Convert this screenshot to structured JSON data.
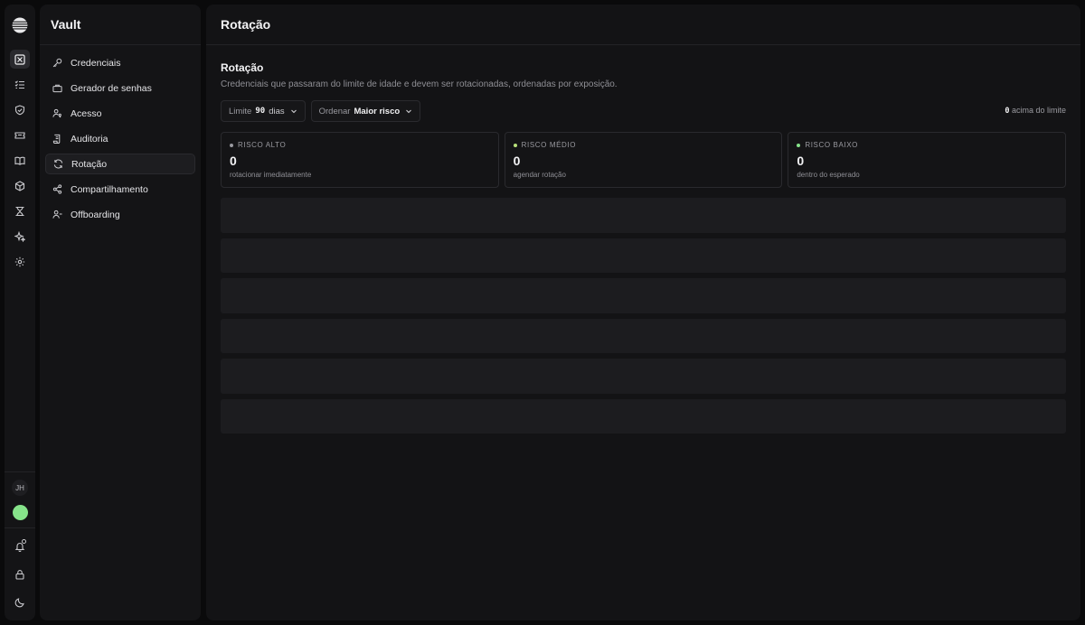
{
  "app": {
    "title": "Vault"
  },
  "rail": {
    "items": [
      {
        "icon": "vault-grid-icon",
        "active": true
      },
      {
        "icon": "checklist-icon",
        "active": false
      },
      {
        "icon": "shield-check-icon",
        "active": false
      },
      {
        "icon": "ticket-icon",
        "active": false
      },
      {
        "icon": "book-icon",
        "active": false
      },
      {
        "icon": "cube-icon",
        "active": false
      },
      {
        "icon": "hourglass-icon",
        "active": false
      },
      {
        "icon": "sparkle-icon",
        "active": false
      },
      {
        "icon": "gear-icon",
        "active": false
      }
    ],
    "user_initials": "JH",
    "status_color": "#86e38a"
  },
  "sidebar": {
    "items": [
      {
        "label": "Credenciais",
        "icon": "key-icon",
        "active": false
      },
      {
        "label": "Gerador de senhas",
        "icon": "generator-icon",
        "active": false
      },
      {
        "label": "Acesso",
        "icon": "user-key-icon",
        "active": false
      },
      {
        "label": "Auditoria",
        "icon": "audit-scroll-icon",
        "active": false
      },
      {
        "label": "Rotação",
        "icon": "rotate-icon",
        "active": true
      },
      {
        "label": "Compartilhamento",
        "icon": "share-icon",
        "active": false
      },
      {
        "label": "Offboarding",
        "icon": "user-minus-icon",
        "active": false
      }
    ]
  },
  "header": {
    "title": "Rotação"
  },
  "section": {
    "title": "Rotação",
    "description": "Credenciais que passaram do limite de idade e devem ser rotacionadas, ordenadas por exposição."
  },
  "toolbar": {
    "limit_label": "Limite",
    "limit_value": "90",
    "limit_unit": "dias",
    "order_label": "Ordenar",
    "order_value": "Maior risco",
    "above_count": "0",
    "above_label": "acima do limite"
  },
  "cards": [
    {
      "label": "RISCO ALTO",
      "value": "0",
      "sub": "rotacionar imediatamente",
      "dot_color": "#9a9aa0"
    },
    {
      "label": "RISCO MÉDIO",
      "value": "0",
      "sub": "agendar rotação",
      "dot_color": "#b7e07a"
    },
    {
      "label": "RISCO BAIXO",
      "value": "0",
      "sub": "dentro do esperado",
      "dot_color": "#86e38a"
    }
  ],
  "skeleton_rows": 6
}
